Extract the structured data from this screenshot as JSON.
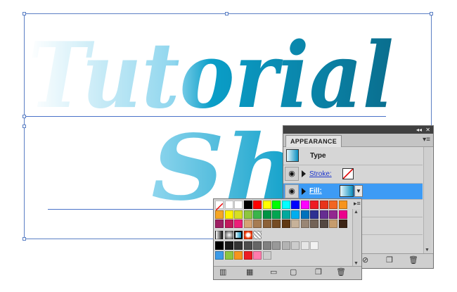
{
  "artwork": {
    "line1": "Tutorial",
    "line2": "Sh",
    "gradient_colors": [
      "#ffffff",
      "#8fd6ee",
      "#0a9ec8",
      "#0a6e8e"
    ]
  },
  "appearance_panel": {
    "tab_label": "APPEARANCE",
    "titlebar_collapse": "◂◂",
    "titlebar_close": "✕",
    "menu_glyph": "▾≡",
    "type_label": "Type",
    "stroke_label": "Stroke:",
    "fill_label": "Fill:",
    "accent_color": "#3d9bf5",
    "link_color": "#1a33cc"
  },
  "swatch_popup": {
    "rows": [
      [
        "none",
        "#ffffff",
        "#ffffff",
        "#000000",
        "#ff0000",
        "#ffff00",
        "#00ff00",
        "#00ffff",
        "#0000ff",
        "#ff00ff",
        "#ee1b24",
        "#e8341c",
        "#f26522",
        "#f7941d"
      ],
      [
        "#f5a623",
        "#fff200",
        "#d7df23",
        "#8dc63f",
        "#39b54a",
        "#009444",
        "#00a651",
        "#00a99d",
        "#00aeef",
        "#0072bc",
        "#2e3192",
        "#662d91",
        "#92278f",
        "#ec008c"
      ],
      [
        "#9e1f63",
        "#c2185b",
        "#ed1e79",
        "#d4a373",
        "#a67c52",
        "#8c6239",
        "#754c24",
        "#603913",
        "#c7b299",
        "#998675",
        "#736357",
        "#534741",
        "#c69c6d",
        "#3c2415"
      ],
      [
        "grad-black",
        "grad-radial",
        "grad-blue",
        "grad-dot",
        "grad-pattern"
      ],
      [
        "#000000",
        "#1a1a1a",
        "#333333",
        "#4d4d4d",
        "#666666",
        "#808080",
        "#999999",
        "#b3b3b3",
        "#cccccc",
        "#e6e6e6",
        "#f2f2f2"
      ],
      [
        "#3c9be8",
        "#8dc63f",
        "#f7941d",
        "#ed1c24",
        "#ff7bac",
        "#cccccc"
      ]
    ]
  }
}
